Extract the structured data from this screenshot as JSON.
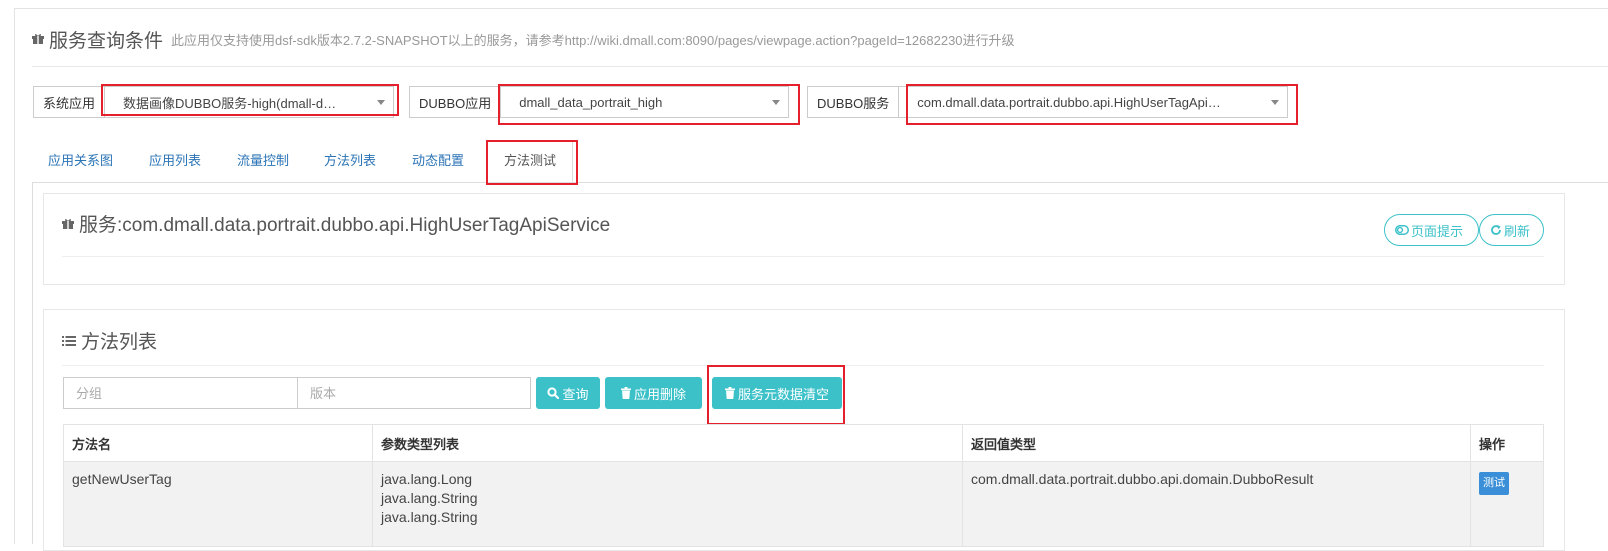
{
  "header": {
    "title": "服务查询条件",
    "note": "此应用仅支持使用dsf-sdk版本2.7.2-SNAPSHOT以上的服务，请参考http://wiki.dmall.com:8090/pages/viewpage.action?pageId=12682230进行升级"
  },
  "selectors": [
    {
      "label": "系统应用",
      "value": "数据画像DUBBO服务-high(dmall-d…"
    },
    {
      "label": "DUBBO应用",
      "value": "dmall_data_portrait_high"
    },
    {
      "label": "DUBBO服务",
      "value": "com.dmall.data.portrait.dubbo.api.HighUserTagApi…"
    }
  ],
  "tabs": [
    "应用关系图",
    "应用列表",
    "流量控制",
    "方法列表",
    "动态配置",
    "方法测试"
  ],
  "active_tab": "方法测试",
  "service_panel": {
    "title": "服务:com.dmall.data.portrait.dubbo.api.HighUserTagApiService",
    "hint_button": "页面提示",
    "refresh_button": "刷新"
  },
  "method_panel": {
    "title": "方法列表",
    "group_placeholder": "分组",
    "version_placeholder": "版本",
    "query_button": "查询",
    "delete_button": "应用删除",
    "clear_button": "服务元数据清空"
  },
  "table": {
    "headers": [
      "方法名",
      "参数类型列表",
      "返回值类型",
      "操作"
    ],
    "rows": [
      {
        "method": "getNewUserTag",
        "params": [
          "java.lang.Long",
          "java.lang.String",
          "java.lang.String"
        ],
        "return_type": "com.dmall.data.portrait.dubbo.api.domain.DubboResult",
        "action": "测试"
      }
    ]
  },
  "colors": {
    "accent": "#3cc1c9",
    "link": "#2b74b6",
    "highlight": "#e3202b",
    "badge": "#3a8fd8"
  }
}
